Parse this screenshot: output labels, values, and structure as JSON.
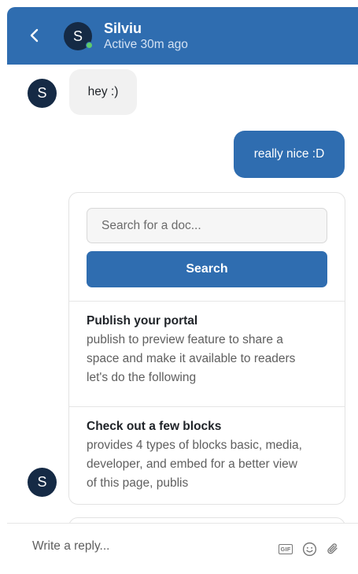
{
  "header": {
    "contact_name": "Silviu",
    "status": "Active 30m ago",
    "avatar_initial": "S",
    "presence": "online",
    "presence_color": "#5ecb6b",
    "brand_color": "#2f6db0"
  },
  "messages": [
    {
      "direction": "incoming",
      "avatar_initial": "S",
      "text": "hey :)"
    },
    {
      "direction": "outgoing",
      "text": "really nice :D"
    }
  ],
  "doc_search": {
    "placeholder": "Search for a doc...",
    "button_label": "Search",
    "results": [
      {
        "title": "Publish your portal",
        "snippet_lines": [
          "publish to preview feature to share a",
          "space and make it available to readers",
          "let's do the following"
        ]
      },
      {
        "title": "Check out a few blocks",
        "snippet_lines": [
          "provides 4 types of blocks basic, media,",
          "developer, and embed for a better view",
          "of this page, publis"
        ]
      }
    ],
    "sender_avatar_initial": "S"
  },
  "composer": {
    "placeholder": "Write a reply...",
    "gif_label": "GIF",
    "icons": [
      "gif-icon",
      "emoji-icon",
      "paperclip-icon"
    ]
  }
}
